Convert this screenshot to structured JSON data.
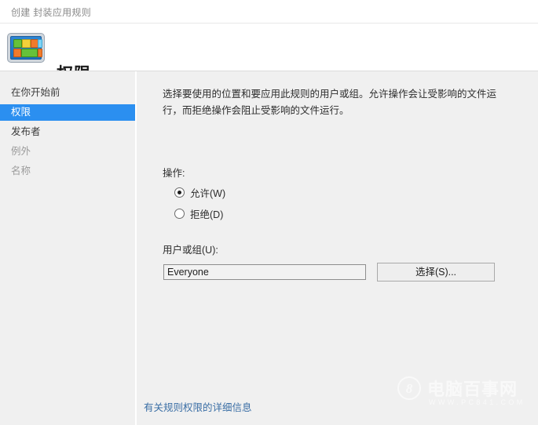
{
  "window": {
    "title": "创建 封装应用规则"
  },
  "header": {
    "icon_name": "applocker-packaged-app-icon",
    "heading": "权限"
  },
  "sidebar": {
    "items": [
      {
        "label": "在你开始前",
        "state": "normal"
      },
      {
        "label": "权限",
        "state": "selected"
      },
      {
        "label": "发布者",
        "state": "normal"
      },
      {
        "label": "例外",
        "state": "muted"
      },
      {
        "label": "名称",
        "state": "muted"
      }
    ]
  },
  "content": {
    "intro": "选择要使用的位置和要应用此规则的用户或组。允许操作会让受影响的文件运行，而拒绝操作会阻止受影响的文件运行。",
    "action_label": "操作:",
    "radios": [
      {
        "label": "允许(W)",
        "checked": true
      },
      {
        "label": "拒绝(D)",
        "checked": false
      }
    ],
    "user_label": "用户或组(U):",
    "user_value": "Everyone",
    "user_placeholder": "",
    "select_button": "选择(S)...",
    "more_info_link": "有关规则权限的详细信息"
  },
  "watermark": {
    "badge": "8",
    "name": "电脑百事网",
    "url": "WWW.PC841.COM"
  },
  "colors": {
    "selection_blue": "#2b8ff0",
    "link_blue": "#3a6ea5",
    "window_bg": "#f0f0f0",
    "header_bg": "#ffffff"
  }
}
